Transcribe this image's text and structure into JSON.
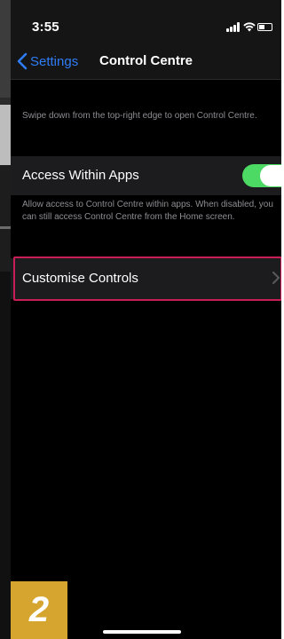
{
  "status_bar": {
    "time": "3:55",
    "icons": [
      "signal-icon",
      "wifi-icon",
      "battery-icon"
    ]
  },
  "nav": {
    "back_label": "Settings",
    "title": "Control Centre"
  },
  "description_top": "Swipe down from the top-right edge to open Control Centre.",
  "access_row": {
    "label": "Access Within Apps",
    "toggle_on": true
  },
  "description_access": "Allow access to Control Centre within apps. When disabled, you can still access Control Centre from the Home screen.",
  "customise_row": {
    "label": "Customise Controls",
    "chevron": "chevron-right-icon"
  },
  "step_badge": "2",
  "colors": {
    "accent_blue": "#2f7cf6",
    "toggle_green": "#4cd964",
    "highlight_red": "#c81d56",
    "badge_gold": "#d6a52f"
  }
}
